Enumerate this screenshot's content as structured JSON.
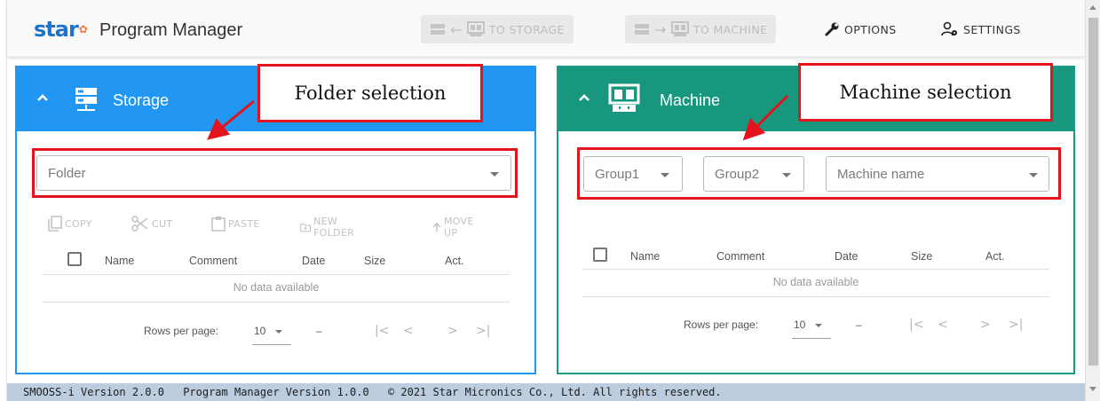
{
  "app": {
    "logo_text": "star",
    "title": "Program Manager"
  },
  "toolbar": {
    "to_storage_label": "TO STORAGE",
    "to_machine_label": "TO MACHINE",
    "options_label": "OPTIONS",
    "settings_label": "SETTINGS"
  },
  "storage": {
    "title": "Storage",
    "folder_placeholder": "Folder",
    "actions": [
      "COPY",
      "CUT",
      "PASTE",
      "NEW FOLDER",
      "MOVE UP"
    ],
    "columns": [
      "Name",
      "Comment",
      "Date",
      "Size",
      "Act."
    ],
    "empty_text": "No data available",
    "rows_per_page_label": "Rows per page:",
    "rows_per_page_value": "10",
    "range_text": "–"
  },
  "machine": {
    "title": "Machine",
    "group1_placeholder": "Group1",
    "group2_placeholder": "Group2",
    "machine_name_placeholder": "Machine name",
    "columns": [
      "Name",
      "Comment",
      "Date",
      "Size",
      "Act."
    ],
    "empty_text": "No data available",
    "rows_per_page_label": "Rows per page:",
    "rows_per_page_value": "10",
    "range_text": "–"
  },
  "annotations": {
    "folder_selection": "Folder selection",
    "machine_selection": "Machine selection"
  },
  "footer": {
    "smooss_version": "SMOOSS-i Version 2.0.0",
    "pm_version": "Program Manager Version 1.0.0",
    "copyright": "© 2021 Star Micronics Co., Ltd. All rights reserved."
  },
  "colors": {
    "storage_header": "#2196f3",
    "machine_header": "#18977f",
    "annotation_red": "#e4141e",
    "footer_bg": "#bccde0",
    "logo_blue": "#1f73c9"
  }
}
